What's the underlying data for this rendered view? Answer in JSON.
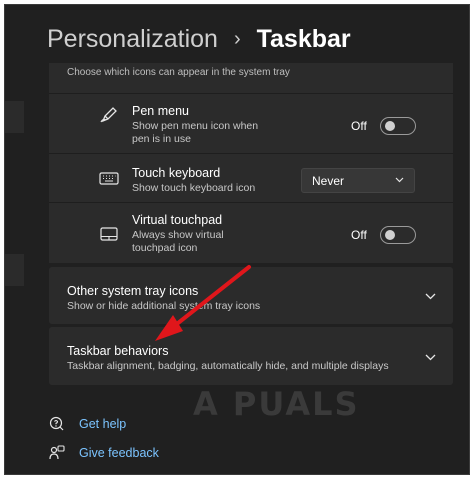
{
  "header": {
    "parent": "Personalization",
    "separator": "›",
    "current": "Taskbar"
  },
  "tray_section": {
    "intro": "Choose which icons can appear in the system tray",
    "items": [
      {
        "title": "Pen menu",
        "desc": "Show pen menu icon when pen is in use",
        "state": "Off",
        "icon": "pen-icon"
      },
      {
        "title": "Touch keyboard",
        "desc": "Show touch keyboard icon",
        "value": "Never",
        "icon": "keyboard-icon"
      },
      {
        "title": "Virtual touchpad",
        "desc": "Always show virtual touchpad icon",
        "state": "Off",
        "icon": "touchpad-icon"
      }
    ]
  },
  "cards": [
    {
      "title": "Other system tray icons",
      "desc": "Show or hide additional system tray icons"
    },
    {
      "title": "Taskbar behaviors",
      "desc": "Taskbar alignment, badging, automatically hide, and multiple displays"
    }
  ],
  "links": [
    {
      "label": "Get help",
      "icon": "help-icon"
    },
    {
      "label": "Give feedback",
      "icon": "feedback-icon"
    }
  ],
  "watermark": "A  PUALS",
  "colors": {
    "background": "#202020",
    "panel": "#2b2b2b",
    "link": "#7cc4ff",
    "annotation_arrow": "#e0161b"
  }
}
